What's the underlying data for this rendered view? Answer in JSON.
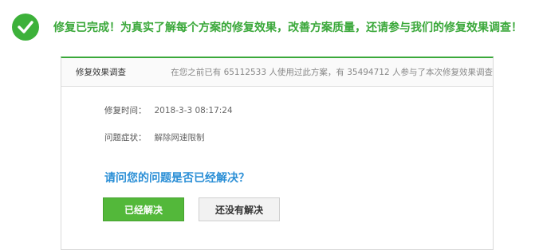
{
  "banner": {
    "text": "修复已完成！为真实了解每个方案的修复效果，改善方案质量，还请参与我们的修复效果调查！",
    "icon": "check-circle-icon",
    "accent_color": "#3db13a"
  },
  "survey": {
    "title": "修复效果调查",
    "stats_prefix": "在您之前已有",
    "users_count": "65112533",
    "stats_mid": "人使用过此方案，有",
    "participants_count": "35494712",
    "stats_suffix": "人参与了本次修复效果调查",
    "fix_time_label": "修复时间：",
    "fix_time_value": "2018-3-3 08:17:24",
    "symptom_label": "问题症状：",
    "symptom_value": "解除网速限制",
    "question": "请问您的问题是否已经解决？",
    "yes_button": "已经解决",
    "no_button": "还没有解决"
  }
}
